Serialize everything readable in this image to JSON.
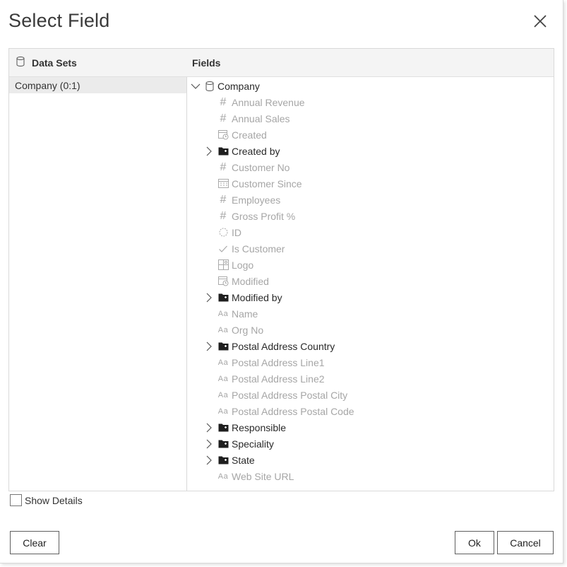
{
  "dialog": {
    "title": "Select Field",
    "close_icon": "close-icon"
  },
  "datasets": {
    "header": "Data Sets",
    "header_icon": "database-icon",
    "items": [
      {
        "label": "Company (0:1)",
        "selected": true
      }
    ]
  },
  "fields": {
    "header": "Fields",
    "root": {
      "label": "Company",
      "icon": "database-icon",
      "expanded": true
    },
    "items": [
      {
        "label": "Annual Revenue",
        "icon": "number-icon",
        "expandable": false
      },
      {
        "label": "Annual Sales",
        "icon": "number-icon",
        "expandable": false
      },
      {
        "label": "Created",
        "icon": "datetime-icon",
        "expandable": false
      },
      {
        "label": "Created by",
        "icon": "folder-link-icon",
        "expandable": true
      },
      {
        "label": "Customer No",
        "icon": "number-icon",
        "expandable": false
      },
      {
        "label": "Customer Since",
        "icon": "calendar-icon",
        "expandable": false
      },
      {
        "label": "Employees",
        "icon": "number-icon",
        "expandable": false
      },
      {
        "label": "Gross Profit %",
        "icon": "number-icon",
        "expandable": false
      },
      {
        "label": "ID",
        "icon": "id-icon",
        "expandable": false
      },
      {
        "label": "Is Customer",
        "icon": "checkmark-icon",
        "expandable": false
      },
      {
        "label": "Logo",
        "icon": "image-icon",
        "expandable": false
      },
      {
        "label": "Modified",
        "icon": "datetime-icon",
        "expandable": false
      },
      {
        "label": "Modified by",
        "icon": "folder-link-icon",
        "expandable": true
      },
      {
        "label": "Name",
        "icon": "text-icon",
        "expandable": false
      },
      {
        "label": "Org No",
        "icon": "text-icon",
        "expandable": false
      },
      {
        "label": "Postal Address Country",
        "icon": "folder-link-icon",
        "expandable": true
      },
      {
        "label": "Postal Address Line1",
        "icon": "text-icon",
        "expandable": false
      },
      {
        "label": "Postal Address Line2",
        "icon": "text-icon",
        "expandable": false
      },
      {
        "label": "Postal Address Postal City",
        "icon": "text-icon",
        "expandable": false
      },
      {
        "label": "Postal Address Postal Code",
        "icon": "text-icon",
        "expandable": false
      },
      {
        "label": "Responsible",
        "icon": "folder-link-icon",
        "expandable": true
      },
      {
        "label": "Speciality",
        "icon": "folder-link-icon",
        "expandable": true
      },
      {
        "label": "State",
        "icon": "folder-link-icon",
        "expandable": true
      },
      {
        "label": "Web Site URL",
        "icon": "text-icon",
        "expandable": false
      }
    ],
    "text_glyph": "Aa",
    "number_glyph": "#"
  },
  "options": {
    "show_details_label": "Show Details",
    "show_details_checked": false
  },
  "buttons": {
    "clear": "Clear",
    "ok": "Ok",
    "cancel": "Cancel"
  },
  "colors": {
    "dim_text": "#a6a6a6",
    "dark_text": "#2a2a2a",
    "header_bg": "#f4f4f4",
    "selected_bg": "#ebebeb",
    "border": "#d9d9d9"
  }
}
